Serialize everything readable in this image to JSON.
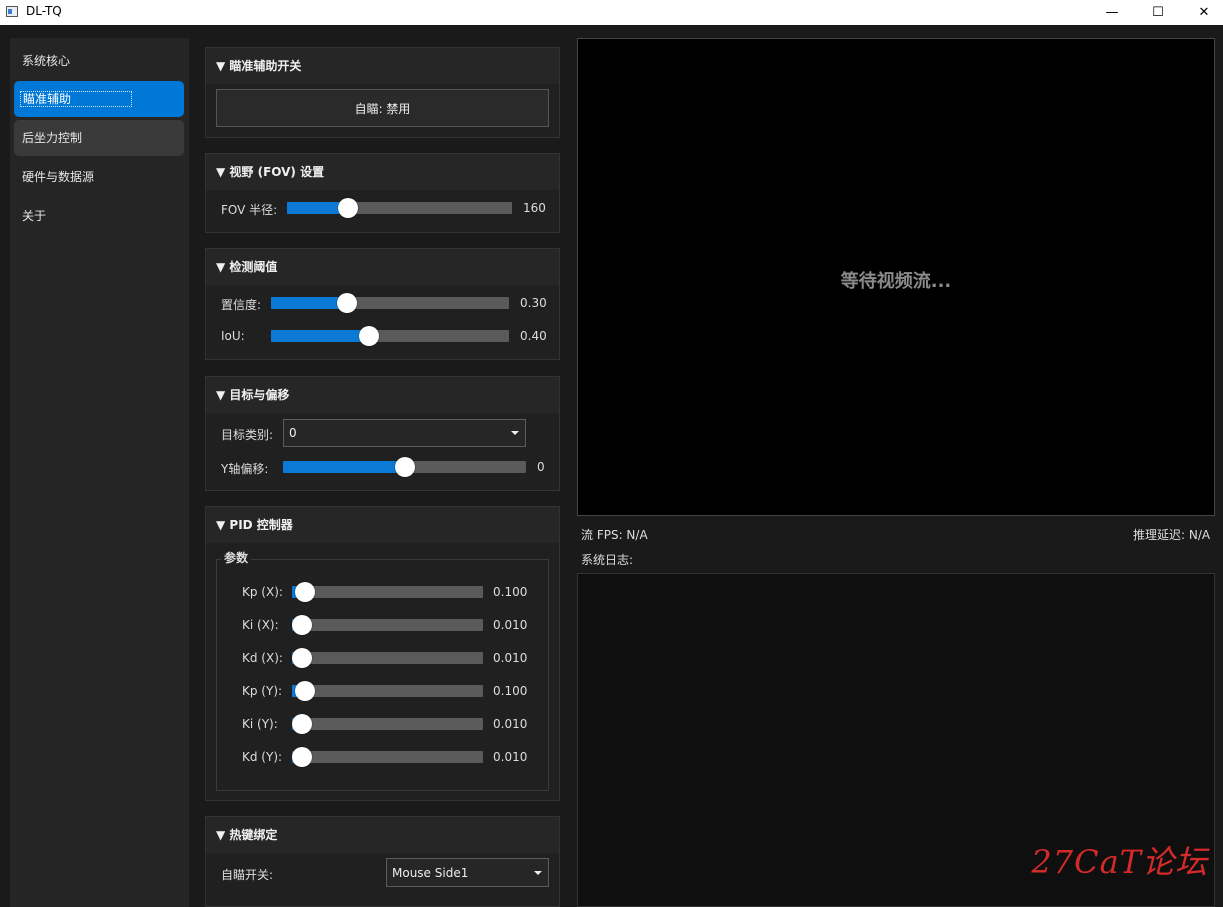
{
  "window": {
    "title": "DL-TQ",
    "minimize": "—",
    "maximize": "☐",
    "close": "✕"
  },
  "sidebar": {
    "items": [
      {
        "label": "系统核心"
      },
      {
        "label": "瞄准辅助"
      },
      {
        "label": "后坐力控制"
      },
      {
        "label": "硬件与数据源"
      },
      {
        "label": "关于"
      }
    ]
  },
  "aim_toggle": {
    "header": "▼ 瞄准辅助开关",
    "button": "自瞄: 禁用"
  },
  "fov": {
    "header": "▼ 视野 (FOV) 设置",
    "label": "FOV 半径:",
    "value": "160",
    "fraction": 0.27
  },
  "threshold": {
    "header": "▼ 检测阈值",
    "confidence_label": "置信度:",
    "confidence_value": "0.30",
    "confidence_fraction": 0.32,
    "iou_label": "IoU:",
    "iou_value": "0.40",
    "iou_fraction": 0.41
  },
  "target": {
    "header": "▼ 目标与偏移",
    "class_label": "目标类别:",
    "class_value": "0",
    "yoffset_label": "Y轴偏移:",
    "yoffset_value": "0",
    "yoffset_fraction": 0.5
  },
  "pid": {
    "header": "▼ PID 控制器",
    "group_title": "参数",
    "params": [
      {
        "label": "Kp (X):",
        "value": "0.100",
        "fraction": 0.07
      },
      {
        "label": "Ki (X):",
        "value": "0.010",
        "fraction": 0.05
      },
      {
        "label": "Kd (X):",
        "value": "0.010",
        "fraction": 0.05
      },
      {
        "label": "Kp (Y):",
        "value": "0.100",
        "fraction": 0.07
      },
      {
        "label": "Ki (Y):",
        "value": "0.010",
        "fraction": 0.05
      },
      {
        "label": "Kd (Y):",
        "value": "0.010",
        "fraction": 0.05
      }
    ]
  },
  "hotkey": {
    "header": "▼ 热键绑定",
    "label": "自瞄开关:",
    "value": "Mouse Side1"
  },
  "video": {
    "placeholder": "等待视频流..."
  },
  "stats": {
    "fps": "流 FPS: N/A",
    "latency": "推理延迟: N/A",
    "log_label": "系统日志:"
  },
  "watermark": "27CaT论坛",
  "colors": {
    "accent": "#0078d7",
    "background": "#1a1a1a",
    "watermark": "#d42a2a"
  }
}
